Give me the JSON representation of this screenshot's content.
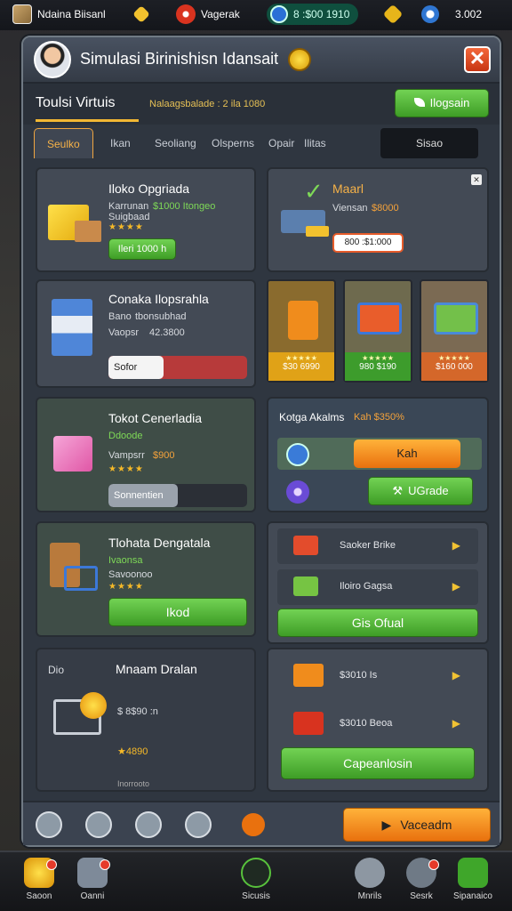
{
  "topbar": {
    "player_name": "Ndaina Biisanl",
    "badge_label": "Vagerak",
    "money": "8 :$00 1910",
    "gems": "3.002"
  },
  "window": {
    "title": "Simulasi Birinishisn Idansait",
    "close_label": "✕"
  },
  "subheader": {
    "title": "Toulsi Virtuis",
    "info": "Nalaagsbalade : 2 ila 1080",
    "button": "Ilogsain"
  },
  "tabs": [
    "Seulko",
    "Ikan",
    "Seoliang",
    "Olsperns",
    "Opair",
    "Ilitas"
  ],
  "tab_right": "Sisao",
  "panels": {
    "store1": {
      "title": "Iloko Opgriada",
      "line1": "Karrunan",
      "line1_value": "$1000 Itongeo",
      "line2": "Suigbaad",
      "stars": "★★★★",
      "button": "Ileri 1000 h"
    },
    "market": {
      "title": "Maarl",
      "line1": "Viensan",
      "line1_value": "$8000",
      "tag": "800 :$1:000"
    },
    "store2": {
      "title": "Conaka Ilopsrahla",
      "line1": "Bano",
      "line1_value": "tbonsubhad",
      "line2": "Vaopsr",
      "line2_value": "42.3800",
      "bar_label": "Sofor Brboro",
      "bar_progress": 0.4
    },
    "shop_cards": [
      {
        "label": "$30 6990",
        "stars": "★★★★★"
      },
      {
        "label": "980 $190",
        "stars": "★★★★★"
      },
      {
        "label": "$160 000",
        "stars": "★★★★★"
      }
    ],
    "store3": {
      "title": "Tokot Cenerladia",
      "line1": "Ddoode",
      "line2": "Vampsrr",
      "line2_value": "$900",
      "stars": "★★★★",
      "bar_label": "Sonnentien",
      "bar_progress": 0.5
    },
    "actions": {
      "title": "Kotga Akalms",
      "title_value": "Kah $350%",
      "button1": "Kah",
      "button2": "UGrade"
    },
    "store4": {
      "title": "Tlohata Dengatala",
      "line1": "Ivaonsa",
      "line2": "Savoonoo",
      "stars": "★★★★",
      "button": "Ikod"
    },
    "list1": {
      "items": [
        "Saoker Brike",
        "Iloiro Gagsa"
      ],
      "button": "Gis Ofual"
    },
    "store5": {
      "tab": "Dio",
      "title": "Mnaam Dralan",
      "line1": "$ 8$90 :n",
      "line2": "★4890",
      "footer": "Inorrooto"
    },
    "list2": {
      "items": [
        "$3010 Is",
        "$3010 Beoa"
      ],
      "button": "Capeanlosin"
    }
  },
  "toolbar": {
    "button": "Vaceadm"
  },
  "bottom_nav": [
    {
      "label": "Saoon"
    },
    {
      "label": "Oanni"
    },
    {
      "label": "Sicusis"
    },
    {
      "label": "Mnrils"
    },
    {
      "label": "Sesrk"
    },
    {
      "label": "Sipanaico"
    }
  ],
  "colors": {
    "accent_green": "#4fb534",
    "accent_orange": "#f08c1c",
    "accent_gold": "#f2b733",
    "panel_bg": "#434a55"
  }
}
